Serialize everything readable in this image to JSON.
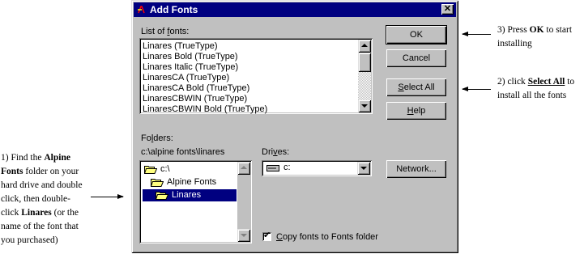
{
  "annotations": {
    "step1": {
      "line1": "1) Find the ",
      "line1_bold": "Alpine",
      "line2_bold": "Fonts",
      "line2": " folder on your",
      "line3": "hard drive and double",
      "line4": "click, then double-",
      "line5_pre": "click ",
      "line5_bold": "Linares",
      "line5_post": " (or the",
      "line6": "name of the font that",
      "line7": "you purchased)"
    },
    "step2": {
      "line1_pre": "2) click ",
      "line1_bold": "Select All",
      "line1_post": " to",
      "line2": "install all the fonts"
    },
    "step3": {
      "line1_pre": "3) Press ",
      "line1_bold": "OK",
      "line1_post": " to start",
      "line2": "installing"
    }
  },
  "dialog": {
    "title": "Add Fonts",
    "close_glyph": "✕",
    "fonts_label_pre": "List of ",
    "fonts_label_key": "f",
    "fonts_label_post": "onts:",
    "fonts": [
      "Linares (TrueType)",
      "Linares Bold (TrueType)",
      "Linares Italic (TrueType)",
      "LinaresCA (TrueType)",
      "LinaresCA Bold (TrueType)",
      "LinaresCBWIN (TrueType)",
      "LinaresCBWIN Bold (TrueType)"
    ],
    "folders_label_pre": "Fo",
    "folders_label_key": "l",
    "folders_label_post": "ders:",
    "current_path": "c:\\alpine fonts\\linares",
    "folder_tree": [
      {
        "label": "c:\\",
        "selected": false
      },
      {
        "label": "Alpine Fonts",
        "selected": false
      },
      {
        "label": "Linares",
        "selected": true
      }
    ],
    "drives_label_pre": "Dri",
    "drives_label_key": "v",
    "drives_label_post": "es:",
    "drive_value": "c:",
    "buttons": {
      "ok": "OK",
      "cancel": "Cancel",
      "select_all_key": "S",
      "select_all_rest": "elect All",
      "help_key": "H",
      "help_rest": "elp",
      "network": "Network..."
    },
    "checkbox": {
      "checked": true,
      "check_glyph": "✔",
      "label_key": "C",
      "label_rest": "opy fonts to Fonts folder"
    }
  },
  "colors": {
    "dialog_face": "#c0c0c0",
    "titlebar": "#000080",
    "selection": "#000080",
    "folder_yellow": "#ffff80"
  }
}
